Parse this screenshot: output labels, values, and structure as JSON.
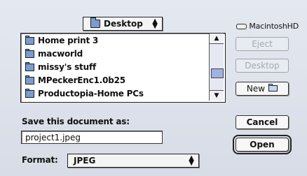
{
  "location_popup": {
    "label": "Desktop"
  },
  "disk": {
    "label": "MacintoshHD"
  },
  "file_list": [
    {
      "name": "Home print 3"
    },
    {
      "name": "macworld"
    },
    {
      "name": "missy's stuff"
    },
    {
      "name": "MPeckerEnc1.0b25"
    },
    {
      "name": "Productopia-Home PCs"
    }
  ],
  "buttons": {
    "eject": "Eject",
    "desktop": "Desktop",
    "new": "New",
    "cancel": "Cancel",
    "open": "Open"
  },
  "save_label": "Save this document as:",
  "filename": "project1.jpeg",
  "format": {
    "label": "Format:",
    "value": "JPEG"
  },
  "icons": [
    "folder-icon",
    "disk-icon",
    "new-folder-icon",
    "up-arrow-icon",
    "down-arrow-icon"
  ]
}
